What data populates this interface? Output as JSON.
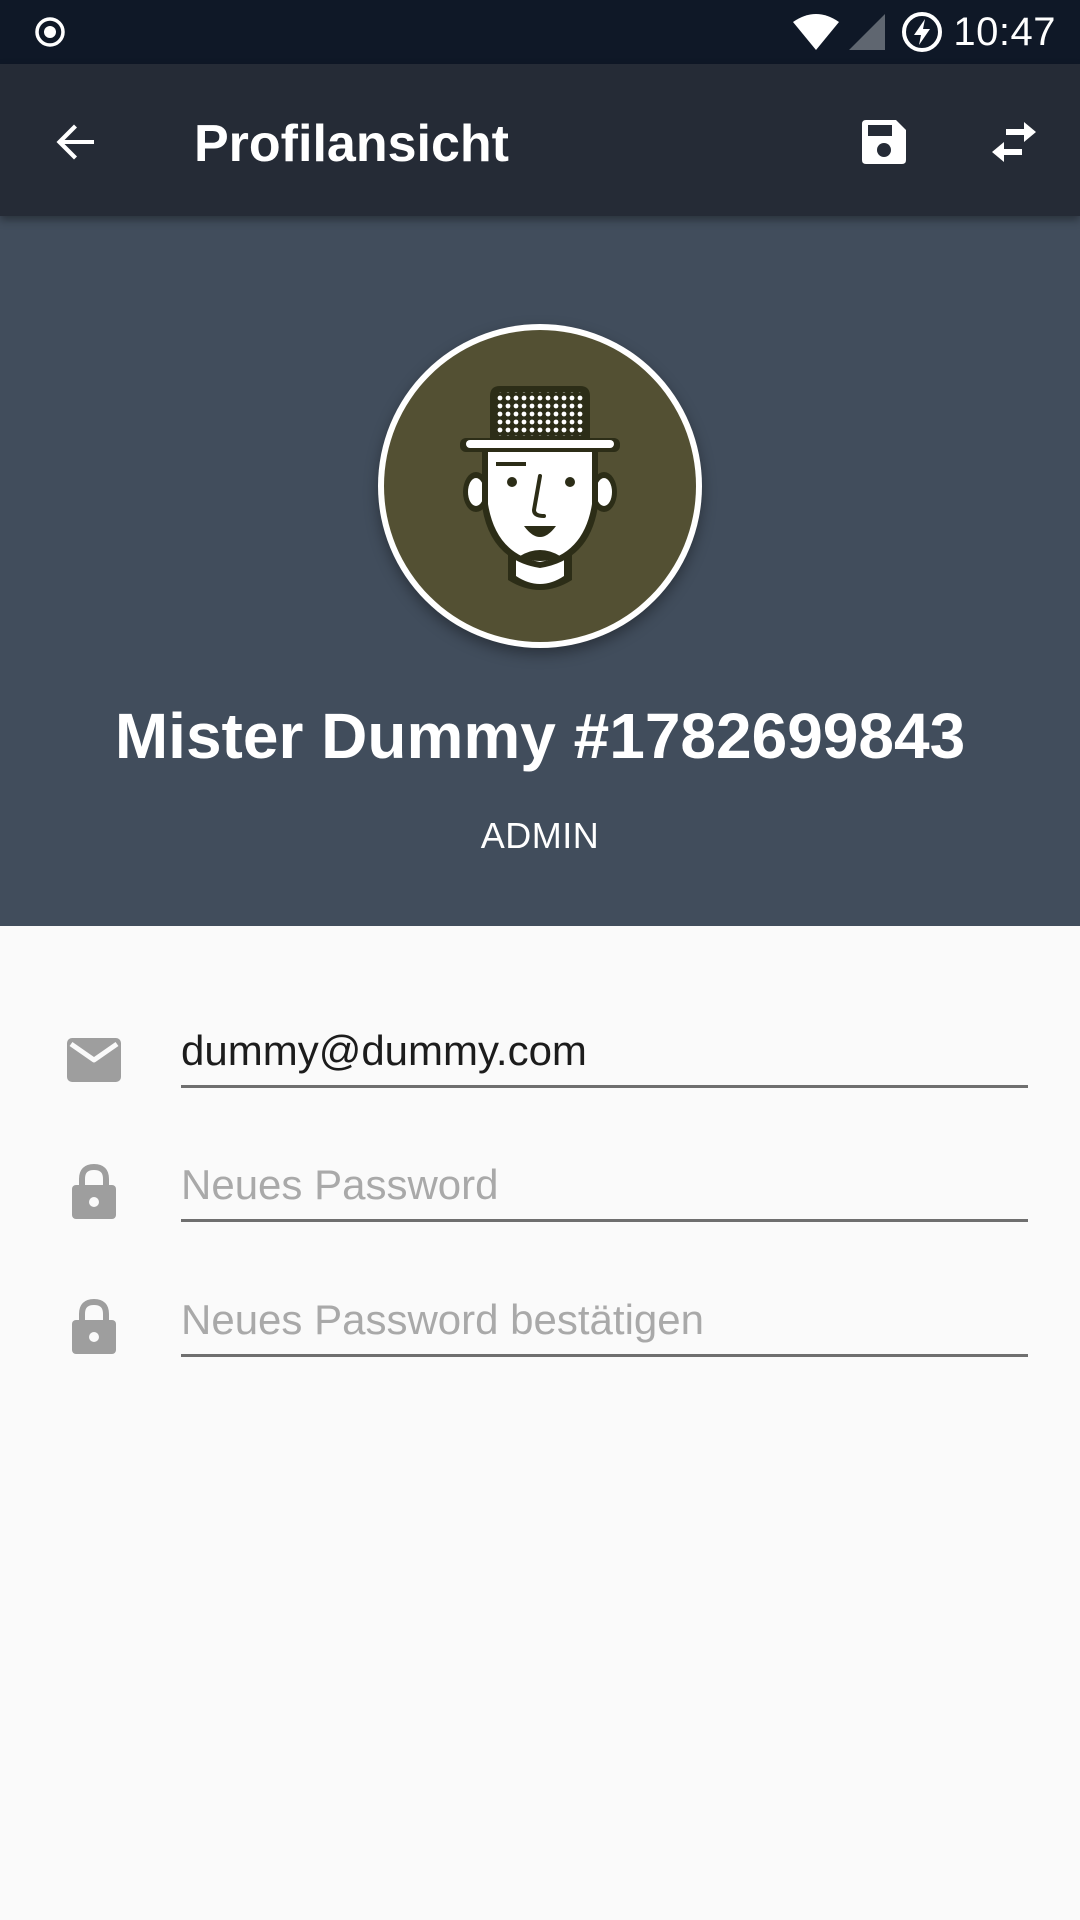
{
  "status_bar": {
    "time": "10:47",
    "icons": [
      "target-icon",
      "wifi-icon",
      "signal-icon",
      "battery-charging-icon"
    ]
  },
  "app_bar": {
    "title": "Profilansicht",
    "icons": {
      "back": "arrow-left-icon",
      "save": "floppy-disk-icon",
      "swap": "swap-arrows-icon"
    }
  },
  "profile": {
    "name": "Mister Dummy #1782699843",
    "role": "ADMIN",
    "avatar": "cartoon-man-with-hat"
  },
  "form": {
    "email": {
      "value": "dummy@dummy.com",
      "placeholder": "",
      "icon": "email-icon"
    },
    "new_password": {
      "value": "",
      "placeholder": "Neues Password",
      "icon": "lock-icon"
    },
    "confirm_password": {
      "value": "",
      "placeholder": "Neues Password bestätigen",
      "icon": "lock-icon"
    }
  },
  "colors": {
    "status_bar": "#0f1827",
    "app_bar": "#252b36",
    "header": "#414d5c",
    "avatar_bg": "#535033",
    "background": "#fafafa",
    "icon_gray": "#9e9e9e"
  }
}
